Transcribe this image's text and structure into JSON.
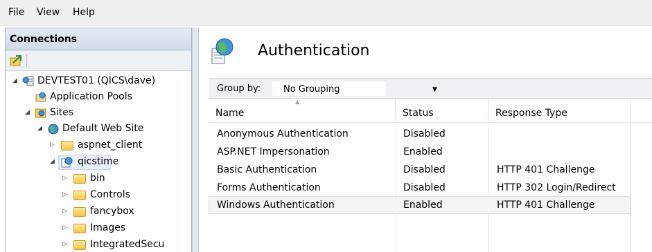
{
  "menu": {
    "items": [
      "File",
      "View",
      "Help"
    ]
  },
  "connections": {
    "title": "Connections",
    "tree": [
      {
        "label": "DEVTEST01 (QICS\\dave)",
        "icon": "server-icon"
      },
      {
        "label": "Application Pools",
        "icon": "app-pools-icon"
      },
      {
        "label": "Sites",
        "icon": "sites-icon"
      },
      {
        "label": "Default Web Site",
        "icon": "globe-icon"
      },
      {
        "label": "aspnet_client",
        "icon": "folder-icon"
      },
      {
        "label": "qicstime",
        "icon": "web-app-icon"
      },
      {
        "label": "bin",
        "icon": "folder-icon"
      },
      {
        "label": "Controls",
        "icon": "folder-icon"
      },
      {
        "label": "fancybox",
        "icon": "folder-icon"
      },
      {
        "label": "Images",
        "icon": "folder-icon"
      },
      {
        "label": "IntegratedSecu",
        "icon": "folder-icon"
      }
    ]
  },
  "page": {
    "title": "Authentication",
    "group_by_label": "Group by:",
    "group_by_value": "No Grouping",
    "columns": [
      "Name",
      "Status",
      "Response Type"
    ],
    "rows": [
      {
        "name": "Anonymous Authentication",
        "status": "Disabled",
        "response": ""
      },
      {
        "name": "ASP.NET Impersonation",
        "status": "Enabled",
        "response": ""
      },
      {
        "name": "Basic Authentication",
        "status": "Disabled",
        "response": "HTTP 401 Challenge"
      },
      {
        "name": "Forms Authentication",
        "status": "Disabled",
        "response": "HTTP 302 Login/Redirect"
      },
      {
        "name": "Windows Authentication",
        "status": "Enabled",
        "response": "HTTP 401 Challenge",
        "selected": true
      }
    ]
  }
}
